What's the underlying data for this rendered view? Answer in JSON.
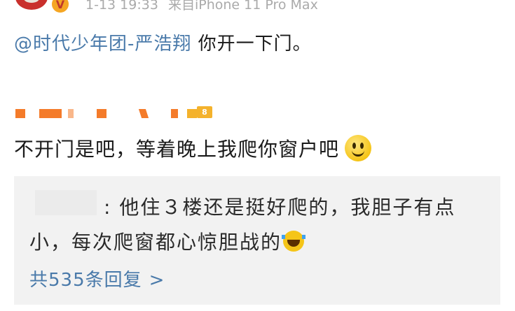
{
  "header": {
    "time": "1-13 19:33",
    "source": "来自iPhone 11 Pro Max",
    "verified_badge": "V"
  },
  "post": {
    "mention": "@时代少年团-严浩翔",
    "text": " 你开一下门。"
  },
  "commenter": {
    "level_badge": "8"
  },
  "comment": {
    "text": "不开门是吧，等着晚上我爬你窗户吧",
    "emoji": "smile-emoji"
  },
  "reply": {
    "prefix": ": 他住３楼还是挺好爬的，我胆子有点小，每次爬窗都心惊胆战的",
    "emoji": "laugh-cry-emoji",
    "more_label": "共535条回复",
    "more_icon": "chevron-right-icon",
    "more_chevron": ">"
  },
  "colors": {
    "link": "#4a7aaa",
    "username_orange": "#f47b2a",
    "meta_gray": "#aaaaaa",
    "reply_bg": "#f2f2f2"
  }
}
